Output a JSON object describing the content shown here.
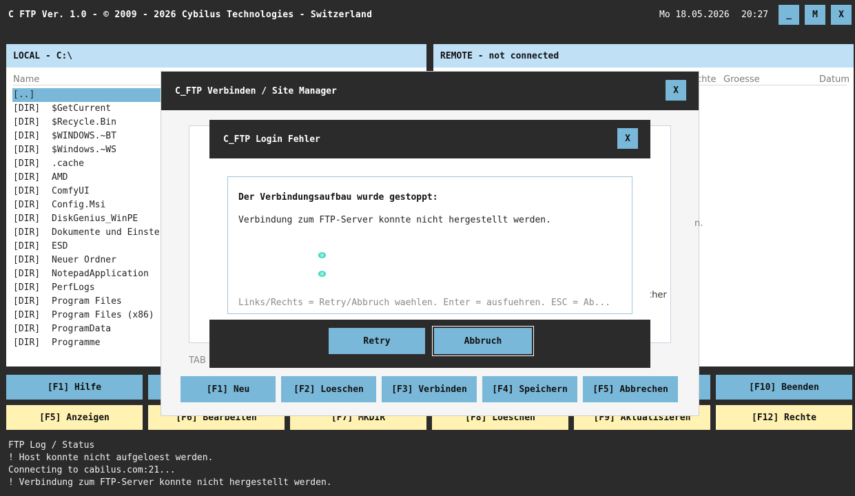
{
  "titlebar": {
    "title": "C FTP Ver. 1.0 - © 2009 - 2026 Cybilus Technologies - Switzerland",
    "date": "Mo 18.05.2026",
    "time": "20:27",
    "minimize": "_",
    "maximize": "M",
    "close": "X"
  },
  "local": {
    "header": "LOCAL - C:\\",
    "col_name": "Name",
    "files": [
      {
        "tag": "[..]",
        "name": ""
      },
      {
        "tag": "[DIR]",
        "name": "$GetCurrent"
      },
      {
        "tag": "[DIR]",
        "name": "$Recycle.Bin"
      },
      {
        "tag": "[DIR]",
        "name": "$WINDOWS.~BT"
      },
      {
        "tag": "[DIR]",
        "name": "$Windows.~WS"
      },
      {
        "tag": "[DIR]",
        "name": ".cache"
      },
      {
        "tag": "[DIR]",
        "name": "AMD"
      },
      {
        "tag": "[DIR]",
        "name": "ComfyUI"
      },
      {
        "tag": "[DIR]",
        "name": "Config.Msi"
      },
      {
        "tag": "[DIR]",
        "name": "DiskGenius_WinPE"
      },
      {
        "tag": "[DIR]",
        "name": "Dokumente und Einste"
      },
      {
        "tag": "[DIR]",
        "name": "ESD"
      },
      {
        "tag": "[DIR]",
        "name": "Neuer Ordner"
      },
      {
        "tag": "[DIR]",
        "name": "NotepadApplication"
      },
      {
        "tag": "[DIR]",
        "name": "PerfLogs"
      },
      {
        "tag": "[DIR]",
        "name": "Program Files"
      },
      {
        "tag": "[DIR]",
        "name": "Program Files (x86)"
      },
      {
        "tag": "[DIR]",
        "name": "ProgramData"
      },
      {
        "tag": "[DIR]",
        "name": "Programme"
      }
    ]
  },
  "remote": {
    "header": "REMOTE - not connected",
    "col_rights": "chte",
    "col_size": "Groesse",
    "col_date": "Datum"
  },
  "fkeys_row1": {
    "f1": "[F1] Hilfe",
    "f10": "[F10] Beenden"
  },
  "fkeys_row2": {
    "f5": "[F5] Anzeigen",
    "f6": "[F6] Bearbeiten",
    "f7": "[F7] MKDIR",
    "f8": "[F8] Loeschen",
    "f9": "[F9] Aktualisieren",
    "f12": "[F12] Rechte"
  },
  "log": {
    "title": "FTP Log / Status",
    "lines": [
      "! Host konnte nicht aufgeloest werden.",
      "Connecting to cabilus.com:21...",
      "! Verbindung zum FTP-Server konnte nicht hergestellt werden."
    ]
  },
  "site_manager": {
    "title": "C_FTP Verbinden / Site Manager",
    "close": "X",
    "tab_hint": "TAB",
    "frag_n": "n.",
    "frag_cher": "cher",
    "buttons": {
      "new": "[F1] Neu",
      "delete": "[F2] Loeschen",
      "connect": "[F3] Verbinden",
      "save": "[F4] Speichern",
      "cancel": "[F5] Abbrechen"
    }
  },
  "error_dialog": {
    "title": "C_FTP Login Fehler",
    "close": "X",
    "heading": "Der Verbindungsaufbau wurde gestoppt:",
    "message": "Verbindung zum FTP-Server konnte nicht hergestellt werden.",
    "hint": "Links/Rechts = Retry/Abbruch waehlen. Enter = ausfuehren. ESC = Ab...",
    "retry": "Retry",
    "abort": "Abbruch"
  }
}
